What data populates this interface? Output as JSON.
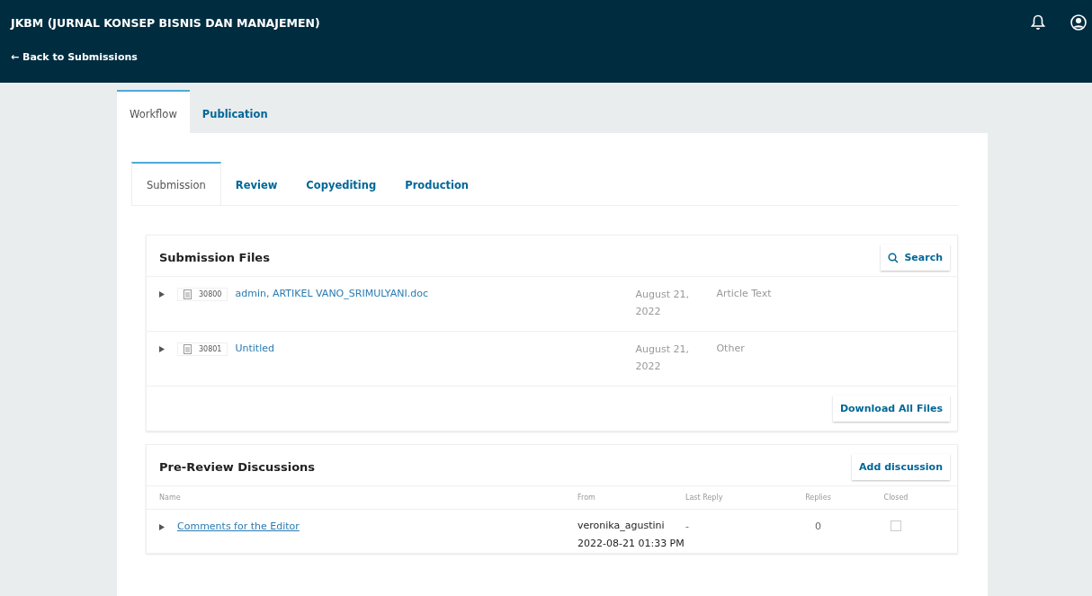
{
  "header": {
    "title": "JKBM (JURNAL KONSEP BISNIS DAN MANAJEMEN)",
    "back_link": "← Back to Submissions"
  },
  "tabs": [
    {
      "label": "Workflow",
      "selected": true
    },
    {
      "label": "Publication",
      "selected": false
    }
  ],
  "stage_tabs": [
    {
      "label": "Submission",
      "selected": true
    },
    {
      "label": "Review",
      "selected": false
    },
    {
      "label": "Copyediting",
      "selected": false
    },
    {
      "label": "Production",
      "selected": false
    }
  ],
  "submission_files": {
    "title": "Submission Files",
    "search_button": "Search",
    "files": [
      {
        "id": "30800",
        "name": "admin, ARTIKEL VANO_SRIMULYANI.doc",
        "date": "August 21, 2022",
        "type": "Article Text"
      },
      {
        "id": "30801",
        "name": "Untitled",
        "date": "August 21, 2022",
        "type": "Other"
      }
    ],
    "download_button": "Download All Files"
  },
  "discussions": {
    "title": "Pre-Review Discussions",
    "add_button": "Add discussion",
    "columns": [
      "Name",
      "From",
      "Last Reply",
      "Replies",
      "Closed"
    ],
    "rows": [
      {
        "name": "Comments for the Editor",
        "from": "veronika_agustini",
        "date": "2022-08-21 01:33 PM",
        "last_reply": "-",
        "replies": "0",
        "closed": false
      }
    ]
  }
}
